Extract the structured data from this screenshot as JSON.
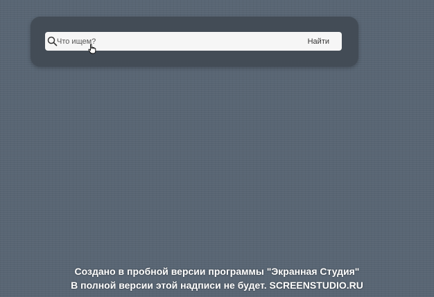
{
  "search": {
    "placeholder": "Что ищем?",
    "value": "",
    "button_label": "Найти",
    "icon": "search-icon"
  },
  "pointer": {
    "icon": "hand-pointer-icon"
  },
  "watermark": {
    "line1": "Создано в пробной версии программы \"Экранная Студия\"",
    "line2": "В полной версии этой надписи не будет. SCREENSTUDIO.RU"
  },
  "colors": {
    "background": "#586573",
    "panel": "#434c56",
    "search_bar": "#f6f6f6",
    "watermark_text": "#ffffff"
  }
}
